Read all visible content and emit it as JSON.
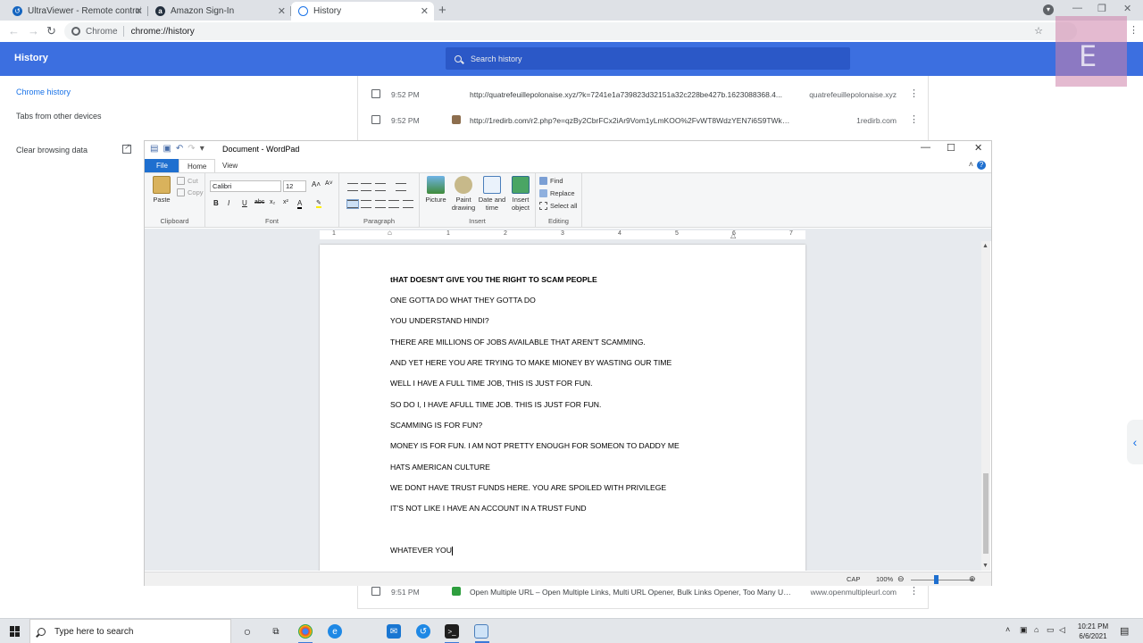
{
  "browser": {
    "tabs": [
      {
        "title": "UltraViewer - Remote control so",
        "favicon_color": "#1565c0"
      },
      {
        "title": "Amazon Sign-In",
        "favicon_color": "#232f3e"
      },
      {
        "title": "History",
        "favicon_color": "#1a73e8"
      }
    ],
    "new_tab": "+",
    "omnibox": {
      "chip": "Chrome",
      "url": "chrome://history"
    }
  },
  "history_page": {
    "title": "History",
    "search_placeholder": "Search history",
    "sidebar": {
      "chrome_history": "Chrome history",
      "tabs_other_devices": "Tabs from other devices",
      "clear_browsing_data": "Clear browsing data"
    },
    "entries_top": [
      {
        "time": "9:52 PM",
        "title": "http://quatrefeuillepolonaise.xyz/?k=7241e1a739823d32151a32c228be427b.1623088368.4...",
        "domain": "quatrefeuillepolonaise.xyz",
        "favicon_color": "#ffffff"
      },
      {
        "time": "9:52 PM",
        "title": "http://1redirb.com/r2.php?e=qzBy2CbrFCx2iAr9Vom1yLmKOO%2FvWT8WdzYEN7i6S9TWkWzQYldSGCQQ...",
        "domain": "1redirb.com",
        "favicon_color": "#8d6e4e"
      }
    ],
    "entries_bottom": [
      {
        "time": "9:51 PM",
        "title": "Open Multiple URL – Open Multiple Links, Multi URL Opener, Bulk Links Opener, Too Many UR...",
        "domain": "www.openmultipleurl.com",
        "favicon_color": "#2e9e3e"
      }
    ]
  },
  "wordpad": {
    "window_title": "Document - WordPad",
    "tabs": {
      "file": "File",
      "home": "Home",
      "view": "View"
    },
    "ribbon": {
      "clipboard": {
        "paste": "Paste",
        "cut": "Cut",
        "copy": "Copy",
        "label": "Clipboard"
      },
      "font": {
        "family": "Calibri",
        "size": "12",
        "label": "Font"
      },
      "paragraph": {
        "label": "Paragraph"
      },
      "insert": {
        "picture": "Picture",
        "paint_drawing": "Paint drawing",
        "date_time": "Date and time",
        "insert_object": "Insert object",
        "label": "Insert"
      },
      "editing": {
        "find": "Find",
        "replace": "Replace",
        "select_all": "Select all",
        "label": "Editing"
      }
    },
    "ruler_numbers": [
      "1",
      "1",
      "2",
      "3",
      "4",
      "5",
      "6",
      "7"
    ],
    "document_lines": [
      {
        "text": "tHAT DOESN'T GIVE YOU THE RIGHT TO SCAM PEOPLE",
        "bold": true
      },
      {
        "text": "ONE GOTTA DO WHAT THEY GOTTA DO",
        "bold": false
      },
      {
        "text": "YOU UNDERSTAND HINDI?",
        "bold": false
      },
      {
        "text": "THERE ARE MILLIONS OF JOBS AVAILABLE THAT AREN'T SCAMMING.",
        "bold": false
      },
      {
        "text": "AND YET HERE YOU ARE TRYING TO MAKE MIONEY BY WASTING OUR TIME",
        "bold": false
      },
      {
        "text": "WELL I HAVE A FULL TIME JOB, THIS IS JUST FOR FUN.",
        "bold": false
      },
      {
        "text": "SO DO I, I HAVE AFULL TIME JOB. THIS IS JUST FOR FUN.",
        "bold": false
      },
      {
        "text": "SCAMMING IS FOR FUN?",
        "bold": false
      },
      {
        "text": "MONEY IS FOR FUN. I AM NOT PRETTY ENOUGH FOR SOMEON TO DADDY ME",
        "bold": false
      },
      {
        "text": "HATS AMERICAN CULTURE",
        "bold": false
      },
      {
        "text": "WE DONT HAVE TRUST FUNDS HERE. YOU ARE SPOILED WITH PRIVILEGE",
        "bold": false
      },
      {
        "text": "IT'S NOT LIKE I HAVE AN ACCOUNT IN A TRUST FUND",
        "bold": false
      },
      {
        "text": "WHATEVER YOU",
        "bold": false
      }
    ],
    "status": {
      "caps": "CAP",
      "zoom": "100%",
      "zoom_level_percent": 100
    }
  },
  "taskbar": {
    "search_placeholder": "Type here to search",
    "clock_time": "10:21 PM",
    "clock_date": "6/6/2021"
  },
  "colors": {
    "history_header": "#3c6fe0",
    "file_tab": "#1e6fcf",
    "link_blue": "#1a73e8"
  }
}
